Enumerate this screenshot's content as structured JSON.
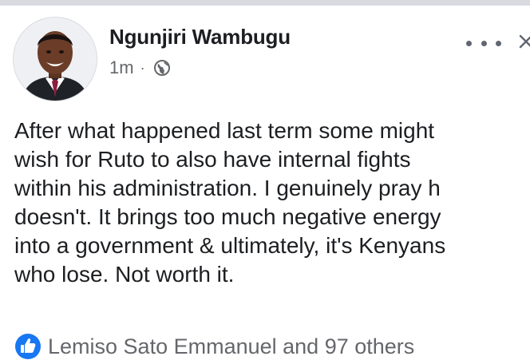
{
  "post": {
    "author": "Ngunjiri Wambugu",
    "time": "1m",
    "separator": "·",
    "privacy_icon": "globe-icon",
    "text_lines": [
      "After what happened last term some might",
      "wish for Ruto to also have internal fights",
      "within his administration. I genuinely pray h",
      "doesn't. It brings too much negative energy",
      "into a government & ultimately, it's Kenyans",
      "who lose. Not worth it."
    ],
    "reactions_text": "Lemiso Sato Emmanuel and 97 others",
    "reaction_icon": "like-icon"
  },
  "colors": {
    "name": "#1c1e21",
    "meta": "#65676b",
    "like_blue": "#1877f2",
    "divider": "#d9dadf"
  }
}
